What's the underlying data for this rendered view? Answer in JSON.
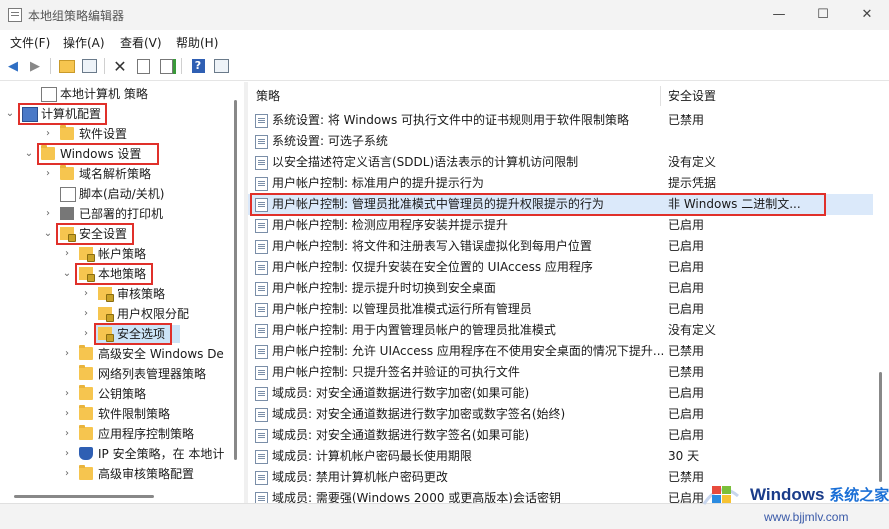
{
  "window": {
    "title": "本地组策略编辑器",
    "minimize": "—",
    "maximize": "☐",
    "close": "✕"
  },
  "menu": [
    "文件(F)",
    "操作(A)",
    "查看(V)",
    "帮助(H)"
  ],
  "tree": [
    {
      "label": "本地计算机 策略",
      "twisty": "",
      "icon": "doc"
    },
    {
      "label": "计算机配置",
      "twisty": "⌄",
      "icon": "computer"
    },
    {
      "label": "软件设置",
      "twisty": "›",
      "icon": "folder"
    },
    {
      "label": "Windows 设置",
      "twisty": "⌄",
      "icon": "folder"
    },
    {
      "label": "域名解析策略",
      "twisty": "›",
      "icon": "folder"
    },
    {
      "label": "脚本(启动/关机)",
      "twisty": "",
      "icon": "doc"
    },
    {
      "label": "已部署的打印机",
      "twisty": "›",
      "icon": "printer"
    },
    {
      "label": "安全设置",
      "twisty": "⌄",
      "icon": "lockfolder"
    },
    {
      "label": "帐户策略",
      "twisty": "›",
      "icon": "lockfolder"
    },
    {
      "label": "本地策略",
      "twisty": "⌄",
      "icon": "lockfolder"
    },
    {
      "label": "审核策略",
      "twisty": "›",
      "icon": "lockfolder"
    },
    {
      "label": "用户权限分配",
      "twisty": "›",
      "icon": "lockfolder"
    },
    {
      "label": "安全选项",
      "twisty": "›",
      "icon": "lockfolder"
    },
    {
      "label": "高级安全 Windows De",
      "twisty": "›",
      "icon": "folder"
    },
    {
      "label": "网络列表管理器策略",
      "twisty": "",
      "icon": "folder"
    },
    {
      "label": "公钥策略",
      "twisty": "›",
      "icon": "folder"
    },
    {
      "label": "软件限制策略",
      "twisty": "›",
      "icon": "folder"
    },
    {
      "label": "应用程序控制策略",
      "twisty": "›",
      "icon": "folder"
    },
    {
      "label": "IP 安全策略，在 本地计",
      "twisty": "›",
      "icon": "shield"
    },
    {
      "label": "高级审核策略配置",
      "twisty": "›",
      "icon": "folder"
    }
  ],
  "columns": {
    "policy": "策略",
    "setting": "安全设置"
  },
  "policies": [
    {
      "name": "系统设置: 将 Windows 可执行文件中的证书规则用于软件限制策略",
      "value": "已禁用"
    },
    {
      "name": "系统设置: 可选子系统",
      "value": ""
    },
    {
      "name": "以安全描述符定义语言(SDDL)语法表示的计算机访问限制",
      "value": "没有定义"
    },
    {
      "name": "用户帐户控制: 标准用户的提升提示行为",
      "value": "提示凭据"
    },
    {
      "name": "用户帐户控制: 管理员批准模式中管理员的提升权限提示的行为",
      "value": "非 Windows 二进制文..."
    },
    {
      "name": "用户帐户控制: 检测应用程序安装并提示提升",
      "value": "已启用"
    },
    {
      "name": "用户帐户控制: 将文件和注册表写入错误虚拟化到每用户位置",
      "value": "已启用"
    },
    {
      "name": "用户帐户控制: 仅提升安装在安全位置的 UIAccess 应用程序",
      "value": "已启用"
    },
    {
      "name": "用户帐户控制: 提示提升时切换到安全桌面",
      "value": "已启用"
    },
    {
      "name": "用户帐户控制: 以管理员批准模式运行所有管理员",
      "value": "已启用"
    },
    {
      "name": "用户帐户控制: 用于内置管理员帐户的管理员批准模式",
      "value": "没有定义"
    },
    {
      "name": "用户帐户控制: 允许 UIAccess 应用程序在不使用安全桌面的情况下提升...",
      "value": "已禁用"
    },
    {
      "name": "用户帐户控制: 只提升签名并验证的可执行文件",
      "value": "已禁用"
    },
    {
      "name": "域成员: 对安全通道数据进行数字加密(如果可能)",
      "value": "已启用"
    },
    {
      "name": "域成员: 对安全通道数据进行数字加密或数字签名(始终)",
      "value": "已启用"
    },
    {
      "name": "域成员: 对安全通道数据进行数字签名(如果可能)",
      "value": "已启用"
    },
    {
      "name": "域成员: 计算机帐户密码最长使用期限",
      "value": "30 天"
    },
    {
      "name": "域成员: 禁用计算机帐户密码更改",
      "value": "已禁用"
    },
    {
      "name": "域成员: 需要强(Windows 2000 或更高版本)会话密钥",
      "value": "已启用"
    }
  ],
  "watermark": {
    "brand": "Windows",
    "brand_cn": "系统之家",
    "url": "www.bjjmlv.com"
  },
  "colors": {
    "highlight_red": "#e0302a",
    "selection": "#cce4f7",
    "folder": "#f6c54f"
  }
}
